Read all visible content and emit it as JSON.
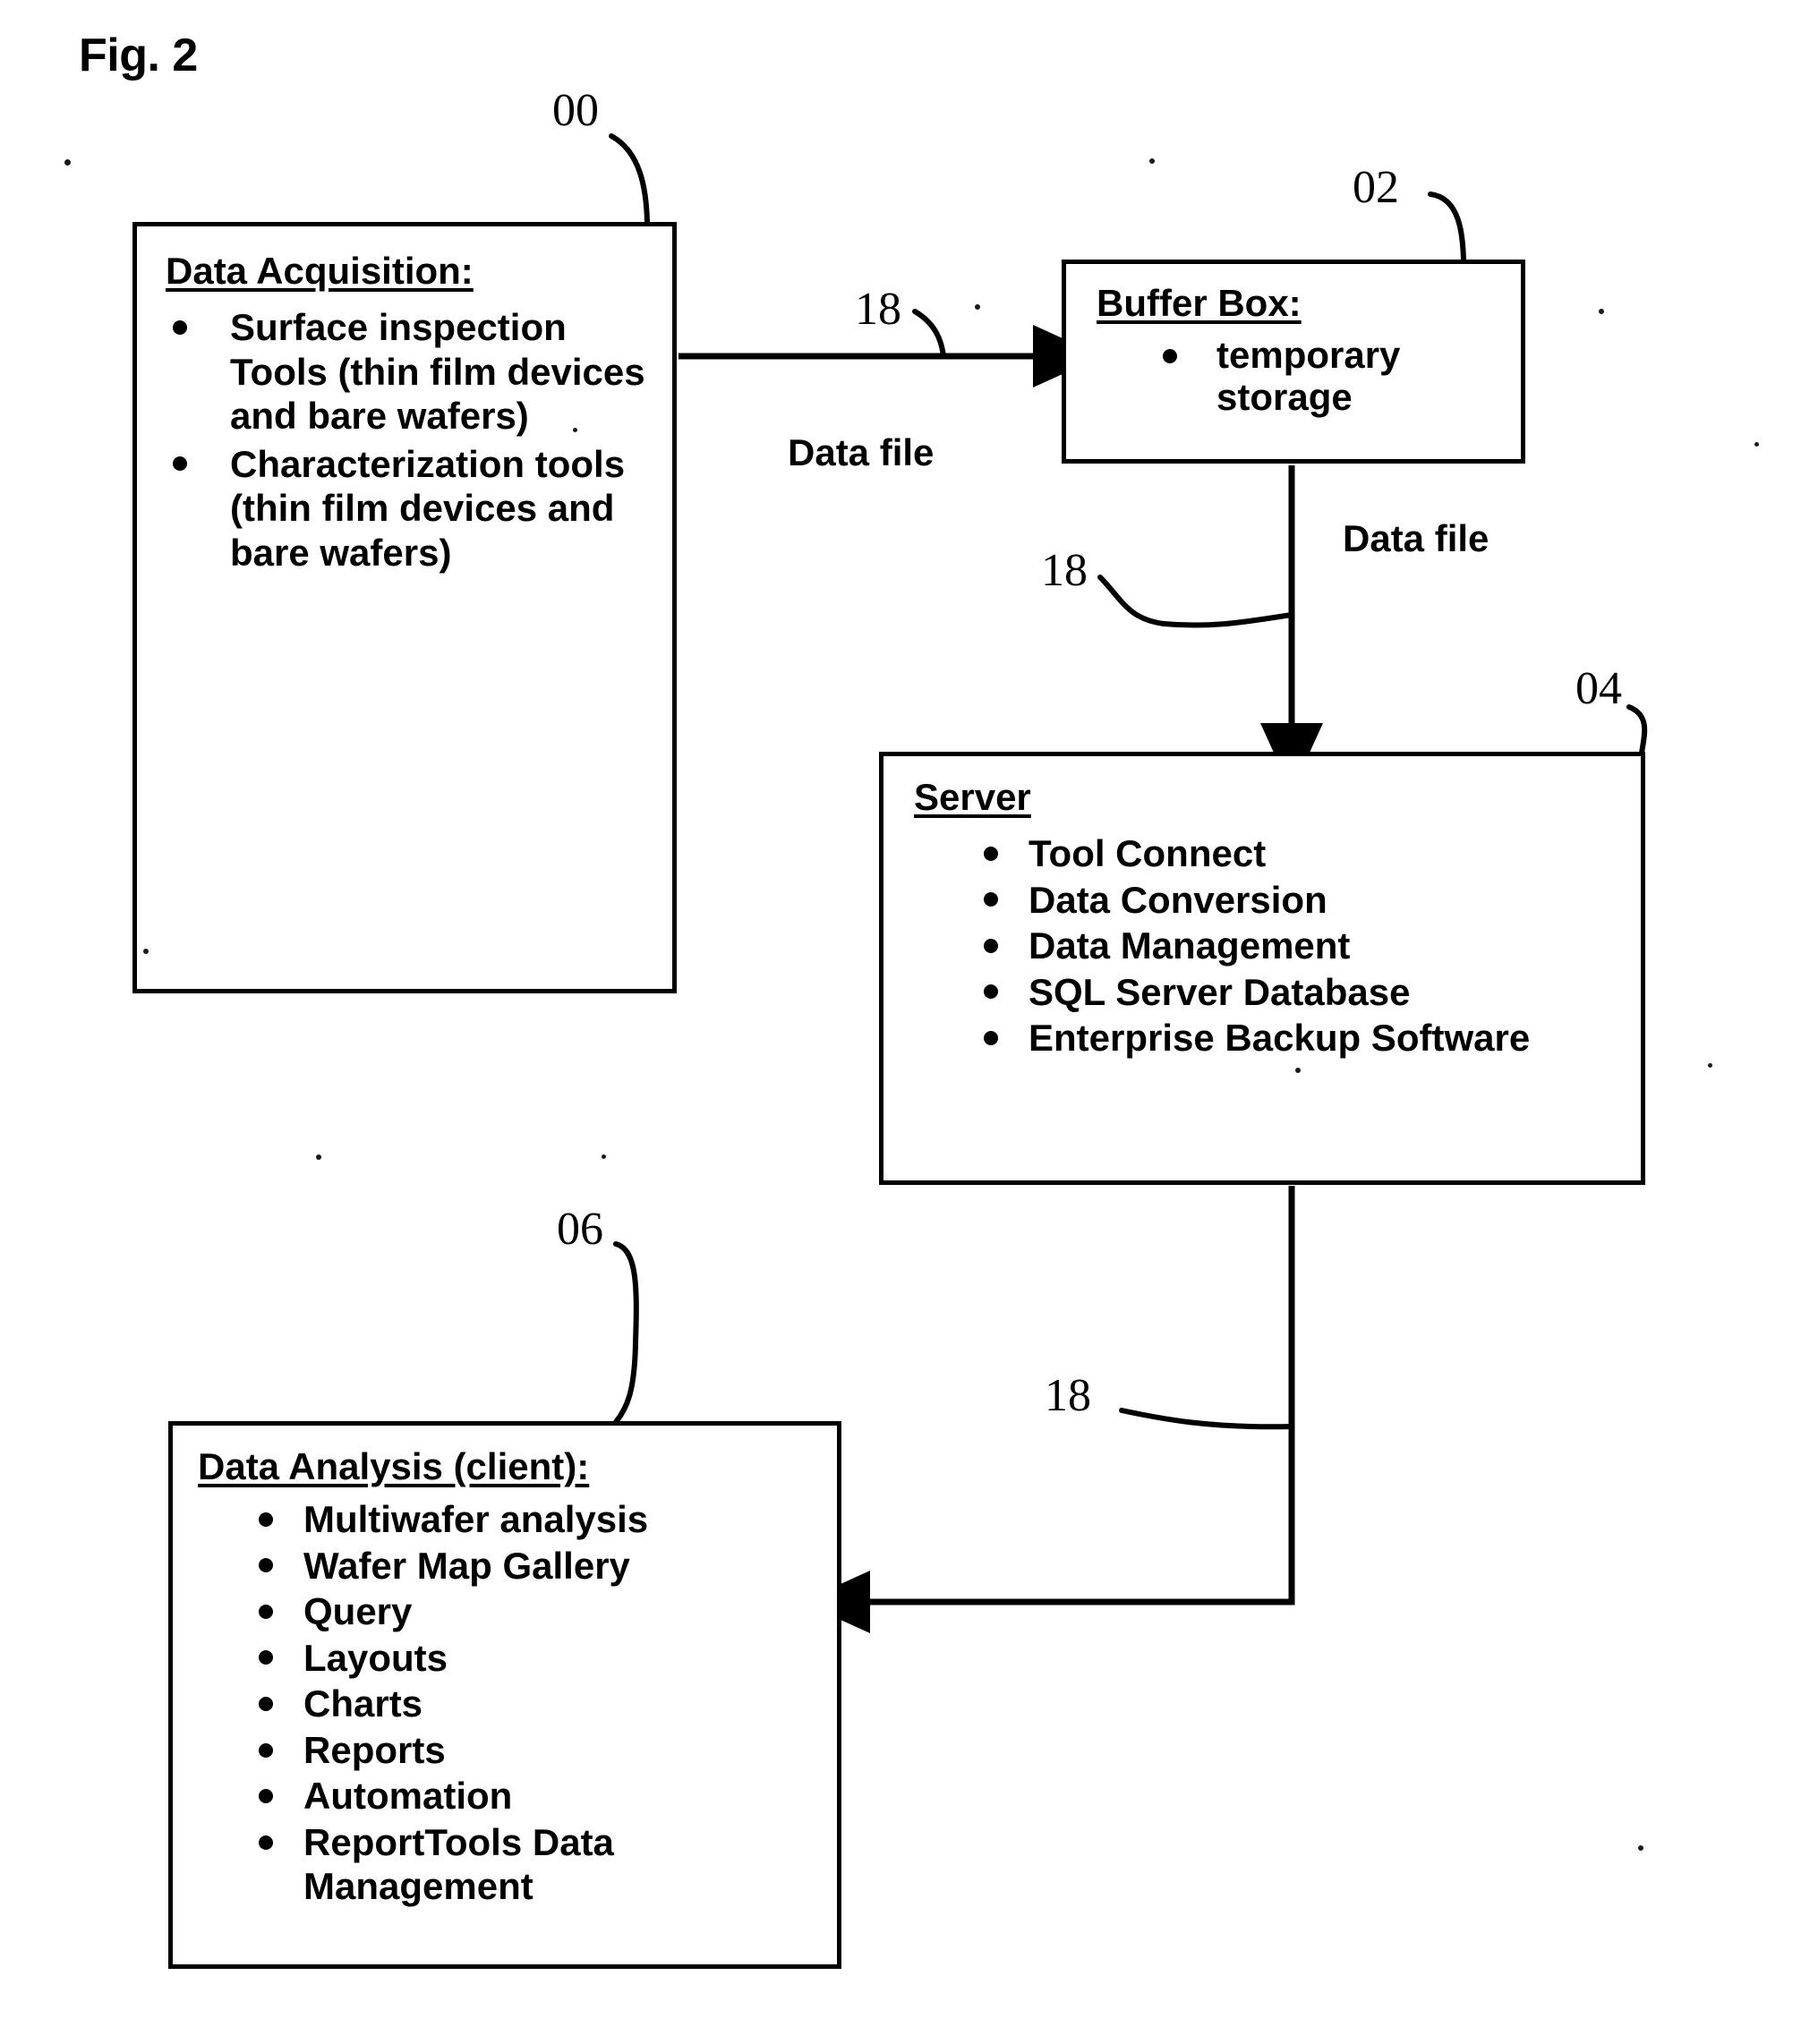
{
  "figure": {
    "title": "Fig. 2"
  },
  "nodes": {
    "acquisition": {
      "ref": "00",
      "title": "Data Acquisition:",
      "bullets": [
        "Surface inspection Tools (thin film devices and bare wafers)",
        "Characterization tools (thin film devices and bare wafers)"
      ]
    },
    "buffer": {
      "ref": "02",
      "title": "Buffer Box:",
      "bullets": [
        "temporary storage"
      ]
    },
    "server": {
      "ref": "04",
      "title": "Server",
      "bullets": [
        "Tool Connect",
        "Data Conversion",
        "Data Management",
        "SQL Server Database",
        "Enterprise Backup Software"
      ]
    },
    "analysis": {
      "ref": "06",
      "title": "Data Analysis (client):",
      "bullets": [
        "Multiwafer analysis",
        "Wafer Map Gallery",
        "Query",
        "Layouts",
        "Charts",
        "Reports",
        "Automation",
        "ReportTools Data Management"
      ]
    }
  },
  "connectors": {
    "acquisition_to_buffer": {
      "ref": "18",
      "label": "Data file"
    },
    "buffer_to_server": {
      "ref": "18",
      "label": "Data file"
    },
    "server_to_analysis": {
      "ref": "18",
      "label": ""
    }
  },
  "colors": {
    "ink": "#000000",
    "paper": "#ffffff"
  }
}
